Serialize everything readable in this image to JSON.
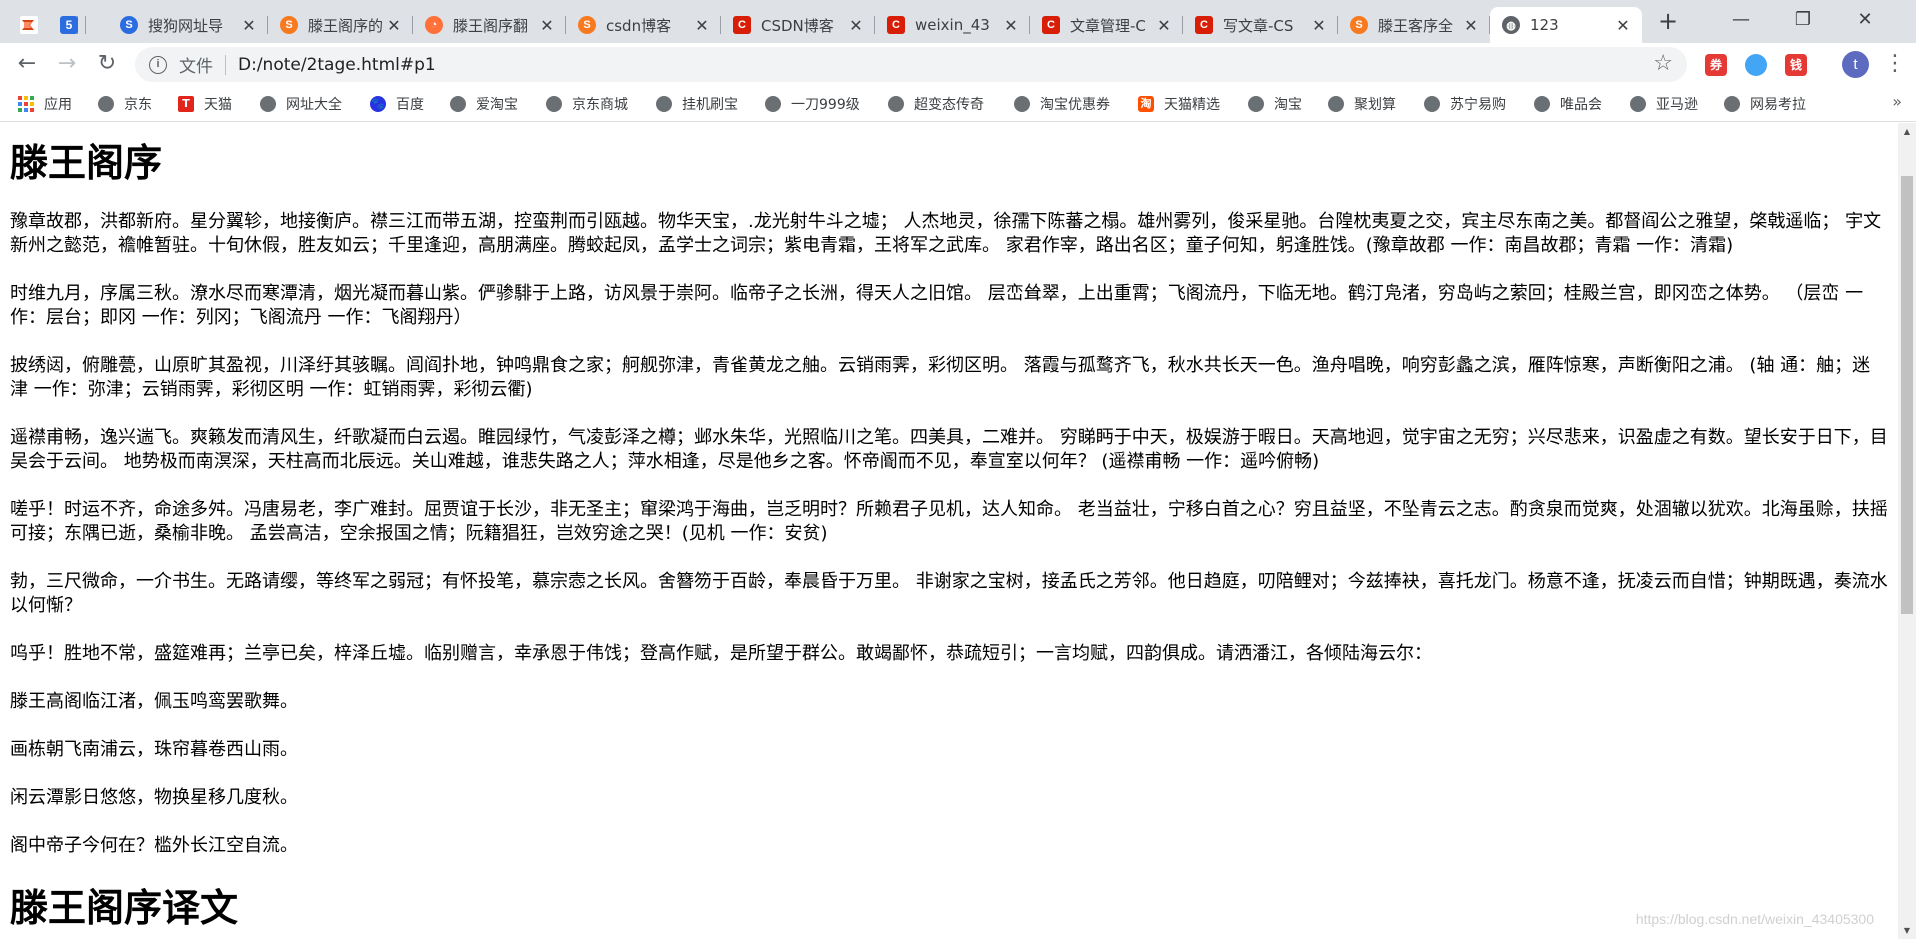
{
  "tabs": [
    {
      "label": "",
      "icon": "app-launcher-icon",
      "color": "#d84315"
    },
    {
      "label": "",
      "icon": "site-5-icon",
      "color": "#2b6de0"
    },
    {
      "label": "搜狗网址导",
      "icon": "sogou-icon"
    },
    {
      "label": "滕王阁序的",
      "icon": "sogou-s-icon"
    },
    {
      "label": "滕王阁序翻",
      "icon": "firefox-flame-icon"
    },
    {
      "label": "csdn博客",
      "icon": "sogou-s-icon"
    },
    {
      "label": "CSDN博客",
      "icon": "csdn-icon"
    },
    {
      "label": "weixin_43",
      "icon": "csdn-icon"
    },
    {
      "label": "文章管理-C",
      "icon": "csdn-icon"
    },
    {
      "label": "写文章-CS",
      "icon": "csdn-icon"
    },
    {
      "label": "滕王客序全",
      "icon": "sogou-s-icon"
    },
    {
      "label": "123",
      "icon": "globe-icon",
      "active": true
    }
  ],
  "toolbar": {
    "file_label": "文件",
    "url": "D:/note/2tage.html#p1",
    "profile_initial": "t"
  },
  "extensions": [
    {
      "label": "券",
      "color": "#e53935"
    },
    {
      "label": "",
      "color": "#42a5f5"
    },
    {
      "label": "钱",
      "color": "#e53935"
    }
  ],
  "bookmarks": [
    {
      "label": "应用",
      "icon": "apps-grid-icon"
    },
    {
      "label": "京东",
      "icon": "globe-icon"
    },
    {
      "label": "天猫",
      "icon": "tmall-icon"
    },
    {
      "label": "网址大全",
      "icon": "globe-icon"
    },
    {
      "label": "百度",
      "icon": "baidu-paw-icon"
    },
    {
      "label": "爱淘宝",
      "icon": "globe-icon"
    },
    {
      "label": "京东商城",
      "icon": "globe-icon"
    },
    {
      "label": "挂机刷宝",
      "icon": "globe-icon"
    },
    {
      "label": "一刀999级",
      "icon": "globe-icon"
    },
    {
      "label": "超变态传奇",
      "icon": "globe-icon"
    },
    {
      "label": "淘宝优惠券",
      "icon": "globe-icon"
    },
    {
      "label": "天猫精选",
      "icon": "tmall-select-icon"
    },
    {
      "label": "淘宝",
      "icon": "globe-icon"
    },
    {
      "label": "聚划算",
      "icon": "globe-icon"
    },
    {
      "label": "苏宁易购",
      "icon": "globe-icon"
    },
    {
      "label": "唯品会",
      "icon": "globe-icon"
    },
    {
      "label": "亚马逊",
      "icon": "globe-icon"
    },
    {
      "label": "网易考拉",
      "icon": "globe-icon"
    }
  ],
  "page": {
    "title": "滕王阁序",
    "paragraphs": [
      "豫章故郡，洪都新府。星分翼轸，地接衡庐。襟三江而带五湖，控蛮荆而引瓯越。物华天宝，.龙光射牛斗之墟； 人杰地灵，徐孺下陈蕃之榻。雄州雾列，俊采星驰。台隍枕夷夏之交，宾主尽东南之美。都督阎公之雅望，棨戟遥临； 宇文新州之懿范，襜帷暂驻。十旬休假，胜友如云；千里逢迎，高朋满座。腾蛟起凤，孟学士之词宗；紫电青霜，王将军之武库。 家君作宰，路出名区；童子何知，躬逢胜饯。(豫章故郡 一作：南昌故郡；青霜 一作：清霜)",
      "时维九月，序属三秋。潦水尽而寒潭清，烟光凝而暮山紫。俨骖騑于上路，访风景于崇阿。临帝子之长洲，得天人之旧馆。 层峦耸翠，上出重霄；飞阁流丹，下临无地。鹤汀凫渚，穷岛屿之萦回；桂殿兰宫，即冈峦之体势。 （层峦 一作：层台；即冈 一作：列冈；飞阁流丹 一作：飞阁翔丹）",
      "披绣闼，俯雕甍，山原旷其盈视，川泽纡其骇瞩。闾阎扑地，钟鸣鼎食之家；舸舰弥津，青雀黄龙之舳。云销雨霁，彩彻区明。 落霞与孤鹜齐飞，秋水共长天一色。渔舟唱晚，响穷彭蠡之滨，雁阵惊寒，声断衡阳之浦。 (轴 通：舳；迷津 一作：弥津；云销雨霁，彩彻区明 一作：虹销雨霁，彩彻云衢)",
      "遥襟甫畅，逸兴遄飞。爽籁发而清风生，纤歌凝而白云遏。睢园绿竹，气凌彭泽之樽；邺水朱华，光照临川之笔。四美具，二难并。 穷睇眄于中天，极娱游于暇日。天高地迥，觉宇宙之无穷；兴尽悲来，识盈虚之有数。望长安于日下，目吴会于云间。 地势极而南溟深，天柱高而北辰远。关山难越，谁悲失路之人；萍水相逢，尽是他乡之客。怀帝阍而不见，奉宣室以何年？ (遥襟甫畅 一作：遥吟俯畅)",
      "嗟乎！时运不齐，命途多舛。冯唐易老，李广难封。屈贾谊于长沙，非无圣主；窜梁鸿于海曲，岂乏明时？所赖君子见机，达人知命。 老当益壮，宁移白首之心？穷且益坚，不坠青云之志。酌贪泉而觉爽，处涸辙以犹欢。北海虽赊，扶摇可接；东隅已逝，桑榆非晚。 孟尝高洁，空余报国之情；阮籍猖狂，岂效穷途之哭！(见机 一作：安贫)",
      "勃，三尺微命，一介书生。无路请缨，等终军之弱冠；有怀投笔，慕宗悫之长风。舍簪笏于百龄，奉晨昏于万里。 非谢家之宝树，接孟氏之芳邻。他日趋庭，叨陪鲤对；今兹捧袂，喜托龙门。杨意不逢，抚凌云而自惜；钟期既遇，奏流水以何惭？",
      "呜乎！胜地不常，盛筵难再；兰亭已矣，梓泽丘墟。临别赠言，幸承恩于伟饯；登高作赋，是所望于群公。敢竭鄙怀，恭疏短引；一言均赋，四韵俱成。请洒潘江，各倾陆海云尔：",
      "滕王高阁临江渚，佩玉鸣鸾罢歌舞。",
      "画栋朝飞南浦云，珠帘暮卷西山雨。",
      "闲云潭影日悠悠，物换星移几度秋。",
      "阁中帝子今何在？槛外长江空自流。"
    ],
    "second_title": "滕王阁序译文"
  },
  "watermark": "https://blog.csdn.net/weixin_43405300"
}
